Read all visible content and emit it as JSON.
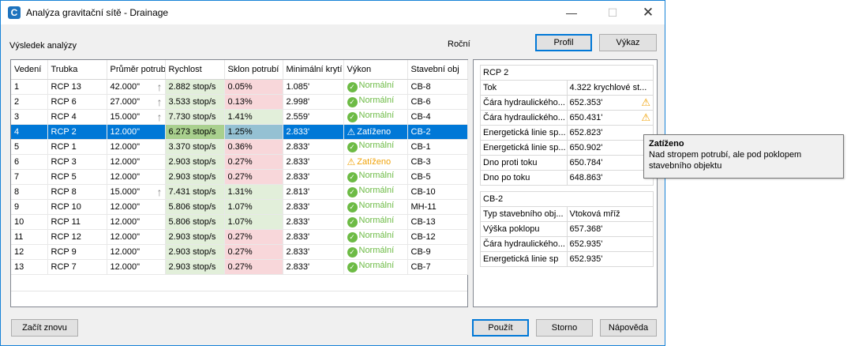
{
  "window": {
    "title": "Analýza gravitační sítě - Drainage",
    "app_icon": "C",
    "minimize": "—",
    "maximize": "☐",
    "close": "✕"
  },
  "section_label": "Výsledek analýzy",
  "period_label": "Roční",
  "buttons": {
    "profile": "Profil",
    "report": "Výkaz",
    "restart": "Začít znovu",
    "apply": "Použít",
    "cancel": "Storno",
    "help": "Nápověda"
  },
  "columns": [
    "Vedení",
    "Trubka",
    "Průměr potrubí",
    "Rychlost",
    "Sklon potrubí",
    "Minimální krytí",
    "Výkon",
    "Stavební obj"
  ],
  "rows": [
    {
      "lead": "1",
      "pipe": "RCP 13",
      "diam": "42.000\"",
      "arrow": true,
      "vel": "2.882 stop/s",
      "slope": "0.05%",
      "slope_color": "red",
      "cover": "1.085'",
      "perf": "Normální",
      "status": "ok",
      "struct": "CB-8"
    },
    {
      "lead": "2",
      "pipe": "RCP 6",
      "diam": "27.000\"",
      "arrow": true,
      "vel": "3.533 stop/s",
      "slope": "0.13%",
      "slope_color": "red",
      "cover": "2.998'",
      "perf": "Normální",
      "status": "ok",
      "struct": "CB-6"
    },
    {
      "lead": "3",
      "pipe": "RCP 4",
      "diam": "15.000\"",
      "arrow": true,
      "vel": "7.730 stop/s",
      "slope": "1.41%",
      "slope_color": "green",
      "cover": "2.559'",
      "perf": "Normální",
      "status": "ok",
      "struct": "CB-4"
    },
    {
      "lead": "4",
      "pipe": "RCP 2",
      "diam": "12.000\"",
      "arrow": false,
      "vel": "6.273 stop/s",
      "slope": "1.25%",
      "slope_color": "green",
      "cover": "2.833'",
      "perf": "Zatíženo",
      "status": "warn",
      "struct": "CB-2",
      "selected": true
    },
    {
      "lead": "5",
      "pipe": "RCP 1",
      "diam": "12.000\"",
      "arrow": false,
      "vel": "3.370 stop/s",
      "slope": "0.36%",
      "slope_color": "red",
      "cover": "2.833'",
      "perf": "Normální",
      "status": "ok",
      "struct": "CB-1"
    },
    {
      "lead": "6",
      "pipe": "RCP 3",
      "diam": "12.000\"",
      "arrow": false,
      "vel": "2.903 stop/s",
      "slope": "0.27%",
      "slope_color": "red",
      "cover": "2.833'",
      "perf": "Zatíženo",
      "status": "warn",
      "struct": "CB-3"
    },
    {
      "lead": "7",
      "pipe": "RCP 5",
      "diam": "12.000\"",
      "arrow": false,
      "vel": "2.903 stop/s",
      "slope": "0.27%",
      "slope_color": "red",
      "cover": "2.833'",
      "perf": "Normální",
      "status": "ok",
      "struct": "CB-5"
    },
    {
      "lead": "8",
      "pipe": "RCP 8",
      "diam": "15.000\"",
      "arrow": true,
      "vel": "7.431 stop/s",
      "slope": "1.31%",
      "slope_color": "green",
      "cover": "2.813'",
      "perf": "Normální",
      "status": "ok",
      "struct": "CB-10"
    },
    {
      "lead": "9",
      "pipe": "RCP 10",
      "diam": "12.000\"",
      "arrow": false,
      "vel": "5.806 stop/s",
      "slope": "1.07%",
      "slope_color": "green",
      "cover": "2.833'",
      "perf": "Normální",
      "status": "ok",
      "struct": "MH-11"
    },
    {
      "lead": "10",
      "pipe": "RCP 11",
      "diam": "12.000\"",
      "arrow": false,
      "vel": "5.806 stop/s",
      "slope": "1.07%",
      "slope_color": "green",
      "cover": "2.833'",
      "perf": "Normální",
      "status": "ok",
      "struct": "CB-13"
    },
    {
      "lead": "11",
      "pipe": "RCP 12",
      "diam": "12.000\"",
      "arrow": false,
      "vel": "2.903 stop/s",
      "slope": "0.27%",
      "slope_color": "red",
      "cover": "2.833'",
      "perf": "Normální",
      "status": "ok",
      "struct": "CB-12"
    },
    {
      "lead": "12",
      "pipe": "RCP 9",
      "diam": "12.000\"",
      "arrow": false,
      "vel": "2.903 stop/s",
      "slope": "0.27%",
      "slope_color": "red",
      "cover": "2.833'",
      "perf": "Normální",
      "status": "ok",
      "struct": "CB-9"
    },
    {
      "lead": "13",
      "pipe": "RCP 7",
      "diam": "12.000\"",
      "arrow": false,
      "vel": "2.903 stop/s",
      "slope": "0.27%",
      "slope_color": "red",
      "cover": "2.833'",
      "perf": "Normální",
      "status": "ok",
      "struct": "CB-7"
    }
  ],
  "pipe_props": {
    "header": "RCP 2",
    "items": [
      {
        "k": "Tok",
        "v": "4.322 krychlové st...",
        "warn": false
      },
      {
        "k": "Čára hydraulického...",
        "v": "652.353'",
        "warn": true
      },
      {
        "k": "Čára hydraulického...",
        "v": "650.431'",
        "warn": true
      },
      {
        "k": "Energetická linie sp...",
        "v": "652.823'",
        "warn": false
      },
      {
        "k": "Energetická linie sp...",
        "v": "650.902'",
        "warn": false
      },
      {
        "k": "Dno proti toku",
        "v": "650.784'",
        "warn": false
      },
      {
        "k": "Dno po toku",
        "v": "648.863'",
        "warn": false
      }
    ]
  },
  "struct_props": {
    "header": "CB-2",
    "items": [
      {
        "k": "Typ stavebního obj...",
        "v": "Vtoková mříž"
      },
      {
        "k": "Výška poklopu",
        "v": "657.368'"
      },
      {
        "k": "Čára hydraulického...",
        "v": "652.935'"
      },
      {
        "k": "Energetická linie sp",
        "v": "652.935'"
      }
    ]
  },
  "tooltip": {
    "title": "Zatíženo",
    "line1": "Nad stropem potrubí, ale pod poklopem",
    "line2": "stavebního objektu"
  },
  "colors": {
    "accent": "#0078d7",
    "ok": "#6dbb45",
    "warn": "#f0a30a",
    "bad_fill": "#f8d7da",
    "good_fill": "#e2efda"
  }
}
